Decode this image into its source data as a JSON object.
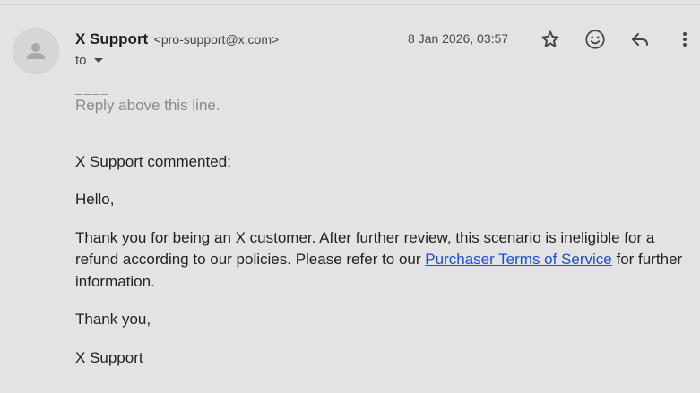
{
  "header": {
    "sender_name": "X Support",
    "sender_email": "<pro-support@x.com>",
    "to_label": "to",
    "date": "8 Jan 2026, 03:57"
  },
  "icons": {
    "avatar": "person-icon",
    "star": "star-icon",
    "emoji": "emoji-icon",
    "reply": "reply-icon",
    "more": "more-vert-icon"
  },
  "body": {
    "separator": "_ _ _ _",
    "reply_above": "Reply above this line.",
    "commented": "X Support commented:",
    "greeting": "Hello,",
    "para_before_link": "Thank you for being an X customer. After further review, this scenario is ineligible for a refund according to our policies. Please refer to our ",
    "link_text": "Purchaser Terms of Service",
    "para_after_link": " for further information.",
    "thanks": "Thank you,",
    "signature": "X Support"
  },
  "colors": {
    "background": "#e3e3e3",
    "link": "#1a4fd0",
    "muted_text": "#8a8a8a"
  }
}
